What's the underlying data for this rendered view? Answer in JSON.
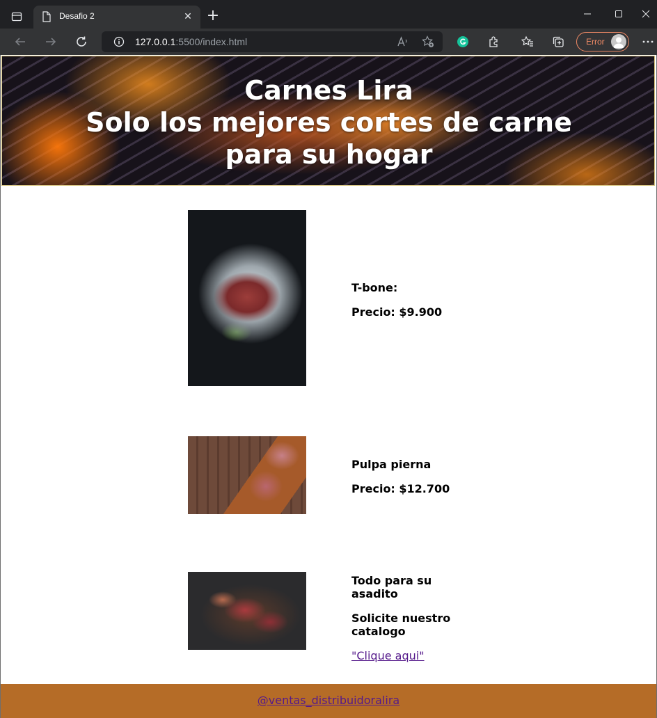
{
  "browser": {
    "tab_title": "Desafio 2",
    "url_host": "127.0.0.1",
    "url_rest": ":5500/index.html",
    "profile_status": "Error"
  },
  "hero": {
    "title": "Carnes Lira",
    "subtitle": "Solo los mejores cortes de carne para su hogar"
  },
  "products": [
    {
      "name": "T-bone:",
      "price": "Precio: $9.900"
    },
    {
      "name": "Pulpa pierna",
      "price": "Precio: $12.700"
    },
    {
      "name": "Todo para su asadito",
      "note": "Solicite nuestro catalogo",
      "link": "\"Clique aqui\""
    }
  ],
  "footer": {
    "link": "@ventas_distribuidoralira"
  },
  "colors": {
    "footer_bg": "#b56c27",
    "link": "#551a8b",
    "error_accent": "#f28b66"
  }
}
